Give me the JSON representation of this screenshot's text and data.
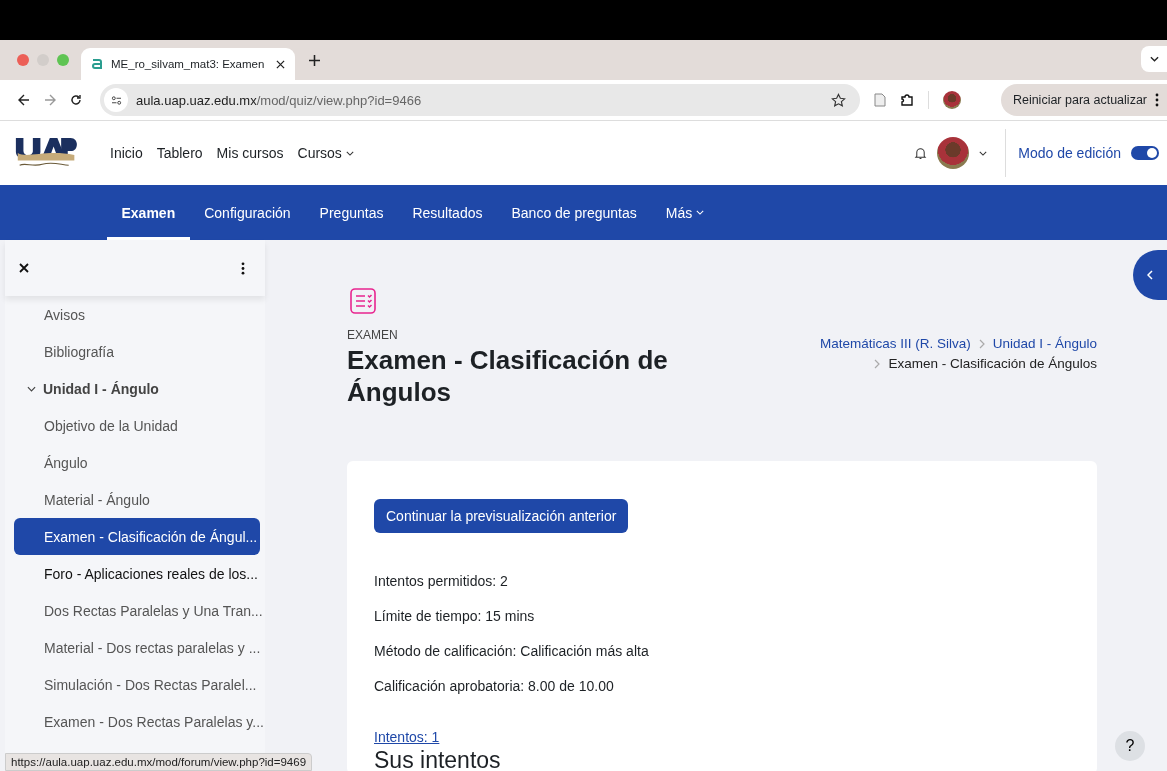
{
  "browser": {
    "tab_title": "ME_ro_silvam_mat3: Examen",
    "address_domain": "aula.uap.uaz.edu.mx",
    "address_path": "/mod/quiz/view.php?id=9466",
    "update_button": "Reiniciar para actualizar"
  },
  "site_nav": {
    "items": [
      {
        "label": "Inicio",
        "dropdown": false
      },
      {
        "label": "Tablero",
        "dropdown": false
      },
      {
        "label": "Mis cursos",
        "dropdown": false
      },
      {
        "label": "Cursos",
        "dropdown": true
      }
    ],
    "edit_mode": {
      "label": "Modo de edición",
      "on": true
    }
  },
  "course_nav": {
    "tabs": [
      {
        "label": "Examen",
        "selected": true,
        "dropdown": false
      },
      {
        "label": "Configuración",
        "selected": false,
        "dropdown": false
      },
      {
        "label": "Preguntas",
        "selected": false,
        "dropdown": false
      },
      {
        "label": "Resultados",
        "selected": false,
        "dropdown": false
      },
      {
        "label": "Banco de preguntas",
        "selected": false,
        "dropdown": false
      },
      {
        "label": "Más",
        "selected": false,
        "dropdown": true
      }
    ]
  },
  "sidebar": {
    "items": [
      {
        "label": "Avisos",
        "selected": false,
        "hovered": false
      },
      {
        "label": "Bibliografía",
        "selected": false,
        "hovered": false
      },
      {
        "label": "Unidad I - Ángulo",
        "expanded": true,
        "children": [
          {
            "label": "Objetivo de la Unidad",
            "selected": false,
            "hovered": false
          },
          {
            "label": "Ángulo",
            "selected": false,
            "hovered": false
          },
          {
            "label": "Material - Ángulo",
            "selected": false,
            "hovered": false
          },
          {
            "label": "Examen - Clasificación de Ángul...",
            "selected": true,
            "hovered": false
          },
          {
            "label": "Foro - Aplicaciones reales de los...",
            "selected": false,
            "hovered": true
          },
          {
            "label": "Dos Rectas Paralelas y Una Tran...",
            "selected": false,
            "hovered": false
          },
          {
            "label": "Material - Dos rectas paralelas y ...",
            "selected": false,
            "hovered": false
          },
          {
            "label": "Simulación - Dos Rectas Paralel...",
            "selected": false,
            "hovered": false
          },
          {
            "label": "Examen - Dos Rectas Paralelas y...",
            "selected": false,
            "hovered": false
          }
        ]
      }
    ]
  },
  "page": {
    "activity_type": "EXAMEN",
    "title": "Examen - Clasificación de Ángulos",
    "breadcrumb": [
      {
        "label": "Matemáticas III (R. Silva)",
        "link": true
      },
      {
        "label": "Unidad I - Ángulo",
        "link": true
      },
      {
        "label": "Examen - Clasificación de Ángulos",
        "link": false
      }
    ],
    "continue_button": "Continuar la previsualización anterior",
    "info": [
      "Intentos permitidos: 2",
      "Límite de tiempo: 15 mins",
      "Método de calificación: Calificación más alta",
      "Calificación aprobatoria: 8.00 de 10.00"
    ],
    "attempts_link": "Intentos: 1",
    "attempts_heading": "Sus intentos"
  },
  "help_button": "?",
  "status_url": "https://aula.uap.uaz.edu.mx/mod/forum/view.php?id=9469"
}
